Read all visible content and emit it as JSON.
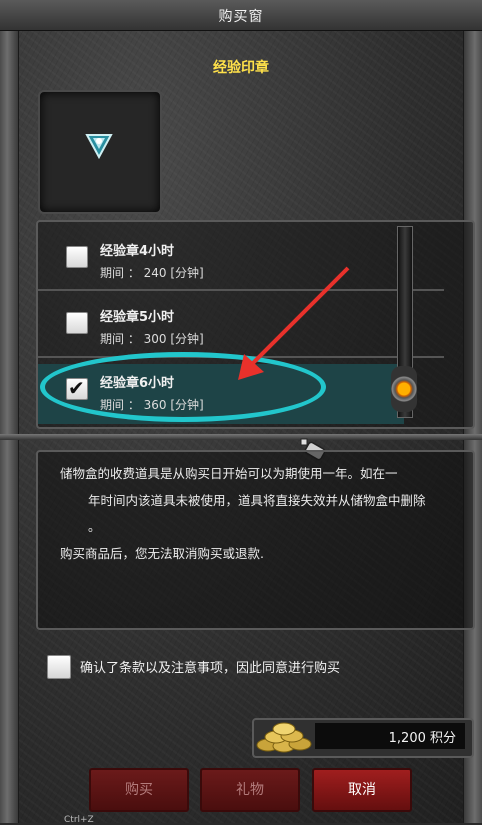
{
  "window": {
    "title": "购买窗"
  },
  "item": {
    "name": "经验印章",
    "icon": "jewel-icon"
  },
  "options": [
    {
      "label": "经验章4小时",
      "period": "期间 ： 240 [分钟]",
      "checked": false
    },
    {
      "label": "经验章5小时",
      "period": "期间 ： 300 [分钟]",
      "checked": false
    },
    {
      "label": "经验章6小时",
      "period": "期间 ： 360 [分钟]",
      "checked": true
    }
  ],
  "notice": {
    "line1": "储物盒的收费道具是从购买日开始可以为期使用一年。如在一",
    "line2": "年时间内该道具未被使用，道具将直接失效并从储物盒中删除",
    "line3": "。",
    "line4": "购买商品后，您无法取消购买或退款."
  },
  "agree": {
    "label": "确认了条款以及注意事项，因此同意进行购买"
  },
  "price": {
    "value": "1,200 积分",
    "icon": "coins-icon"
  },
  "buttons": {
    "buy": "购买",
    "gift": "礼物",
    "cancel": "取消"
  },
  "hint": "Ctrl+Z",
  "colors": {
    "highlight": "#22c6cc",
    "arrow": "#e8312b",
    "title": "#ffe14a",
    "selected_row": "#1e4447"
  }
}
